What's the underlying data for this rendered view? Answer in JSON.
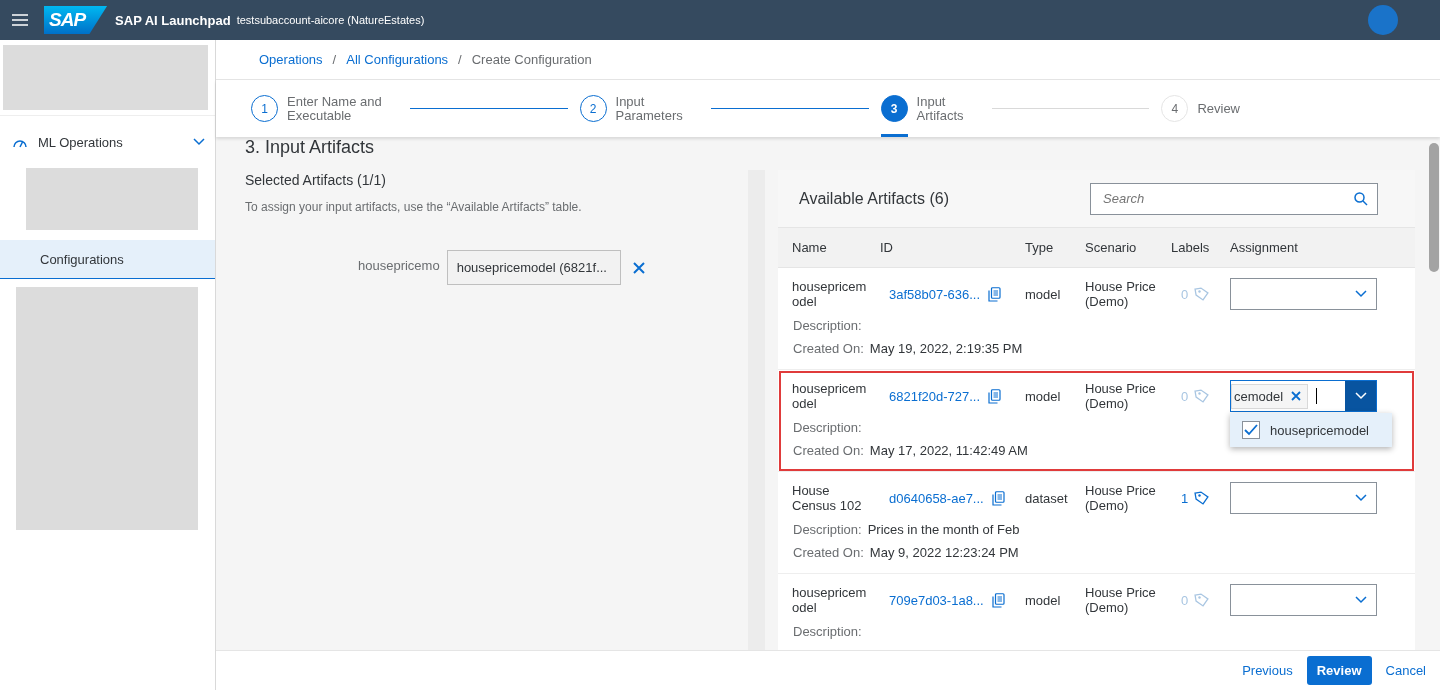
{
  "header": {
    "logo": "SAP",
    "title": "SAP AI Launchpad",
    "account": "testsubaccount-aicore (NatureEstates)"
  },
  "sidebar": {
    "items": [
      {
        "kind": "redacted"
      },
      {
        "kind": "group",
        "label": "ML Operations",
        "expanded": true,
        "selected": false
      },
      {
        "kind": "redacted"
      },
      {
        "kind": "item",
        "label": "Configurations",
        "selected": true
      },
      {
        "kind": "redacted"
      }
    ]
  },
  "breadcrumb": [
    {
      "kind": "link",
      "label": "Operations"
    },
    {
      "kind": "separator",
      "label": "/"
    },
    {
      "kind": "link",
      "label": "All Configurations"
    },
    {
      "kind": "separator",
      "label": "/"
    },
    {
      "kind": "current",
      "label": "Create Configuration"
    }
  ],
  "steps": [
    {
      "number": "1",
      "label": [
        "Enter Name and",
        "Executable"
      ],
      "completed": true,
      "selected": false
    },
    {
      "number": "2",
      "label": [
        "Input",
        "Parameters"
      ],
      "completed": true,
      "selected": false
    },
    {
      "number": "3",
      "label": [
        "Input",
        "Artifacts"
      ],
      "completed": false,
      "selected": true
    },
    {
      "number": "4",
      "label": [
        "Review"
      ],
      "completed": false,
      "selected": false
    }
  ],
  "section": {
    "title": "3. Input Artifacts",
    "subtitle": "Selected Artifacts (1/1)",
    "hint": "To assign your input artifacts, use the “Available Artifacts” table.",
    "assignments": [
      {
        "label": "housepricemo",
        "value": "housepricemodel (6821f..."
      }
    ]
  },
  "available": {
    "title": "Available Artifacts (6)",
    "search": {
      "placeholder": "Search"
    },
    "columns": [
      "Name",
      "ID",
      "Type",
      "Scenario",
      "Labels",
      "Assignment"
    ],
    "rows": [
      {
        "name": "housepricemodel",
        "id": "3af58b07-636...",
        "type": "model",
        "scenario": "House Price (Demo)",
        "labels": "0",
        "labels_active": false,
        "highlighted": false,
        "fields": [
          {
            "label": "Description:"
          },
          {
            "label": "Created On:",
            "value": "May 19, 2022, 2:19:35 PM"
          }
        ],
        "assignment": {
          "open": false
        }
      },
      {
        "name": "housepricemodel",
        "id": "6821f20d-727...",
        "type": "model",
        "scenario": "House Price (Demo)",
        "labels": "0",
        "labels_active": false,
        "highlighted": true,
        "fields": [
          {
            "label": "Description:"
          },
          {
            "label": "Created On:",
            "value": "May 17, 2022, 11:42:49 AM"
          }
        ],
        "assignment": {
          "open": true,
          "tokens": [
            "cemodel"
          ],
          "options": [
            {
              "label": "housepricemodel",
              "checked": true
            }
          ]
        }
      },
      {
        "name": "House Census 102",
        "id": "d0640658-ae7...",
        "type": "dataset",
        "scenario": "House Price (Demo)",
        "labels": "1",
        "labels_active": true,
        "highlighted": false,
        "fields": [
          {
            "label": "Description:",
            "value": "Prices in the month of Feb"
          },
          {
            "label": "Created On:",
            "value": "May 9, 2022 12:23:24 PM"
          }
        ],
        "assignment": {
          "open": false
        }
      },
      {
        "name": "housepricemodel",
        "id": "709e7d03-1a8...",
        "type": "model",
        "scenario": "House Price (Demo)",
        "labels": "0",
        "labels_active": false,
        "highlighted": false,
        "fields": [
          {
            "label": "Description:"
          }
        ],
        "assignment": {
          "open": false
        }
      }
    ]
  },
  "footer": {
    "buttons": [
      {
        "label": "Previous",
        "kind": "transparent"
      },
      {
        "label": "Review",
        "kind": "emphasized"
      },
      {
        "label": "Cancel",
        "kind": "transparent"
      }
    ]
  }
}
